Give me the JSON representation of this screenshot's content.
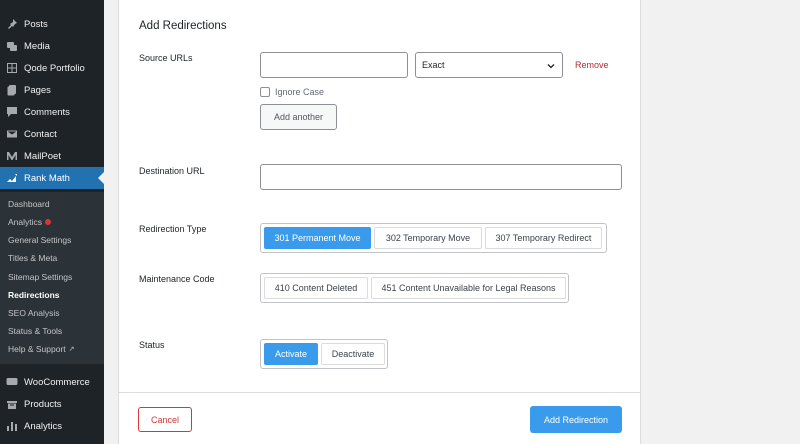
{
  "sidebar": {
    "top_items": [
      {
        "label": "Posts",
        "icon": "pin-icon"
      },
      {
        "label": "Media",
        "icon": "media-icon"
      },
      {
        "label": "Qode Portfolio",
        "icon": "portfolio-icon"
      },
      {
        "label": "Pages",
        "icon": "pages-icon"
      },
      {
        "label": "Comments",
        "icon": "comments-icon"
      },
      {
        "label": "Contact",
        "icon": "mail-icon"
      },
      {
        "label": "MailPoet",
        "icon": "mailpoet-icon"
      },
      {
        "label": "Rank Math",
        "icon": "rank-math-icon"
      }
    ],
    "submenu": [
      {
        "label": "Dashboard"
      },
      {
        "label": "Analytics"
      },
      {
        "label": "General Settings"
      },
      {
        "label": "Titles & Meta"
      },
      {
        "label": "Sitemap Settings"
      },
      {
        "label": "Redirections"
      },
      {
        "label": "SEO Analysis"
      },
      {
        "label": "Status & Tools"
      },
      {
        "label": "Help & Support"
      }
    ],
    "bottom_items": [
      {
        "label": "WooCommerce",
        "icon": "woocommerce-icon"
      },
      {
        "label": "Products",
        "icon": "products-icon"
      },
      {
        "label": "Analytics",
        "icon": "analytics-icon"
      }
    ]
  },
  "form": {
    "title": "Add Redirections",
    "source": {
      "label": "Source URLs",
      "value": "",
      "match_type": "Exact",
      "remove": "Remove",
      "ignore_case": "Ignore Case",
      "add_another": "Add another"
    },
    "destination": {
      "label": "Destination URL",
      "value": ""
    },
    "redirection_type": {
      "label": "Redirection Type",
      "options": [
        "301 Permanent Move",
        "302 Temporary Move",
        "307 Temporary Redirect"
      ],
      "selected": "301 Permanent Move"
    },
    "maintenance_code": {
      "label": "Maintenance Code",
      "options": [
        "410 Content Deleted",
        "451 Content Unavailable for Legal Reasons"
      ]
    },
    "status": {
      "label": "Status",
      "options": [
        "Activate",
        "Deactivate"
      ],
      "selected": "Activate"
    },
    "cancel": "Cancel",
    "submit": "Add Redirection"
  },
  "colors": {
    "sidebar_bg": "#1d2327",
    "submenu_bg": "#2c3338",
    "menu_active": "#2271b1",
    "accent": "#3a9bec",
    "danger": "#d63638",
    "remove_link": "#b32d2e"
  }
}
